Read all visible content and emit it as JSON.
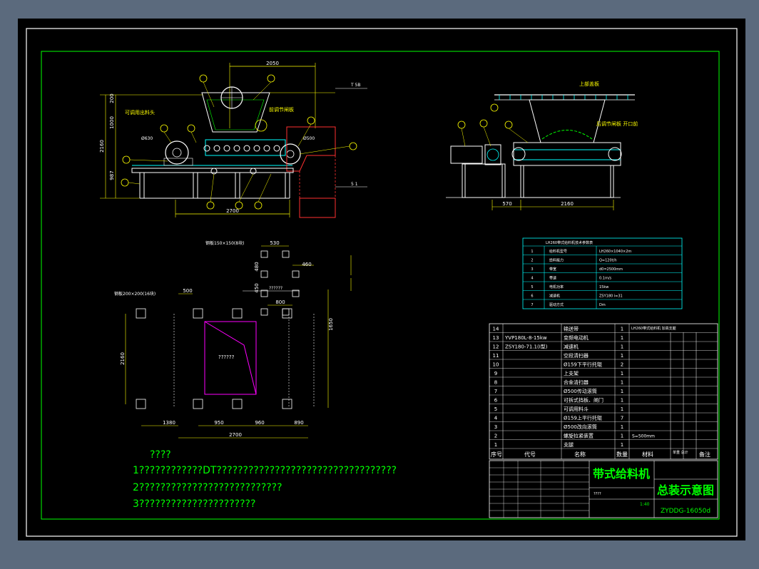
{
  "colors": {
    "frame_bg": "#5b6a7d",
    "sheet_bg": "#000000",
    "border": "#ffffff",
    "inner_border": "#00ff00",
    "line_yellow": "#ffff00",
    "line_cyan": "#00ffff",
    "line_green": "#00ff00",
    "line_magenta": "#ff00ff",
    "line_white": "#ffffff",
    "line_red": "#ff3030",
    "text_white": "#ffffff",
    "text_yellow": "#ffff00",
    "text_green": "#00ff00"
  },
  "front_view": {
    "dim_top": "2050",
    "dim_bottom": "2700",
    "dim_left_total": "2160",
    "dim_left_upper": "1000",
    "dim_left_top": "200",
    "dim_left_lower": "987",
    "level_top": "T 5B",
    "level_bottom": "5 1",
    "dim_roller": "Ø630",
    "dim_roller2": "Ø500",
    "callout_adjust": "前调节闸板",
    "callout_adjustable": "可调用出料头",
    "balloons": [
      "1",
      "2",
      "3",
      "4",
      "5",
      "6",
      "7",
      "8",
      "9",
      "10",
      "11"
    ]
  },
  "side_view": {
    "dim_left": "570",
    "dim_right": "2160",
    "callout_top": "上部盖板",
    "callout_gate": "后调节闸板 开口前",
    "balloons": [
      "12",
      "13",
      "14"
    ]
  },
  "foundation_view": {
    "label_bolt_small": "钢板150×150(8块)",
    "label_bolt_large": "钢板200×200(16块)",
    "dim_530": "530",
    "dim_460": "460",
    "dim_480": "480",
    "dim_450": "450",
    "dim_800": "800",
    "dim_500": "500",
    "dim_1650": "1650",
    "dim_2160": "2160",
    "dim_1380": "1380",
    "dim_950": "950",
    "dim_960": "960",
    "dim_890": "890",
    "dim_2700": "2700",
    "opening_label": "??????",
    "small_label": "??????"
  },
  "specs_table": {
    "title": "LH260带式给料机技术参数表",
    "rows": [
      {
        "no": "1",
        "name": "给料机型号",
        "value": "LH260×1040×2m"
      },
      {
        "no": "2",
        "name": "给料能力",
        "value": "Q=120t/h"
      },
      {
        "no": "3",
        "name": "带宽",
        "value": "d0=2500mm"
      },
      {
        "no": "4",
        "name": "带速",
        "value": "0.1m/s"
      },
      {
        "no": "5",
        "name": "电机功率",
        "value": "15kw"
      },
      {
        "no": "6",
        "name": "减速机",
        "value": "ZSY180 i=31"
      },
      {
        "no": "7",
        "name": "驱动方式",
        "value": "Dm"
      }
    ]
  },
  "bom": {
    "header_right": "LH260带式给料机 加高支腿",
    "rows": [
      {
        "no": "14",
        "code": "",
        "name": "输送带",
        "qty": "1"
      },
      {
        "no": "13",
        "code": "YVP180L-8-15kw",
        "name": "变频电动机",
        "qty": "1"
      },
      {
        "no": "12",
        "code": "ZSY180-71.1(I型)",
        "name": "减速机",
        "qty": "1"
      },
      {
        "no": "11",
        "code": "",
        "name": "空段清扫器",
        "qty": "1"
      },
      {
        "no": "10",
        "code": "",
        "name": "Ø159下平行托辊",
        "qty": "2"
      },
      {
        "no": "9",
        "code": "",
        "name": "上支架",
        "qty": "1"
      },
      {
        "no": "8",
        "code": "",
        "name": "合金清扫器",
        "qty": "1"
      },
      {
        "no": "7",
        "code": "",
        "name": "Ø500传动滚筒",
        "qty": "1"
      },
      {
        "no": "6",
        "code": "",
        "name": "可拆式挡板、闸门",
        "qty": "1"
      },
      {
        "no": "5",
        "code": "",
        "name": "可调用料斗",
        "qty": "1"
      },
      {
        "no": "4",
        "code": "",
        "name": "Ø159上平行托辊",
        "qty": "7"
      },
      {
        "no": "3",
        "code": "",
        "name": "Ø500改向滚筒",
        "qty": "1"
      },
      {
        "no": "2",
        "code": "",
        "name": "螺旋拉紧装置",
        "qty": "1",
        "remark": "S=500mm"
      },
      {
        "no": "1",
        "code": "",
        "name": "支腿",
        "qty": "1"
      }
    ],
    "header": {
      "no": "序号",
      "code": "代号",
      "name": "名称",
      "qty": "数量",
      "material": "材料",
      "weight": "单重 总计",
      "remark": "备注"
    }
  },
  "title_block": {
    "product_name": "带式给料机",
    "drawing_title": "总装示意图",
    "drawing_number": "ZYDDG-16050d",
    "scale": "1:40",
    "mark": "????"
  },
  "notes": {
    "heading": "????",
    "line1": "1????????????DT??????????????????????????????????",
    "line2": "2???????????????????????????",
    "line3": "3??????????????????????"
  }
}
